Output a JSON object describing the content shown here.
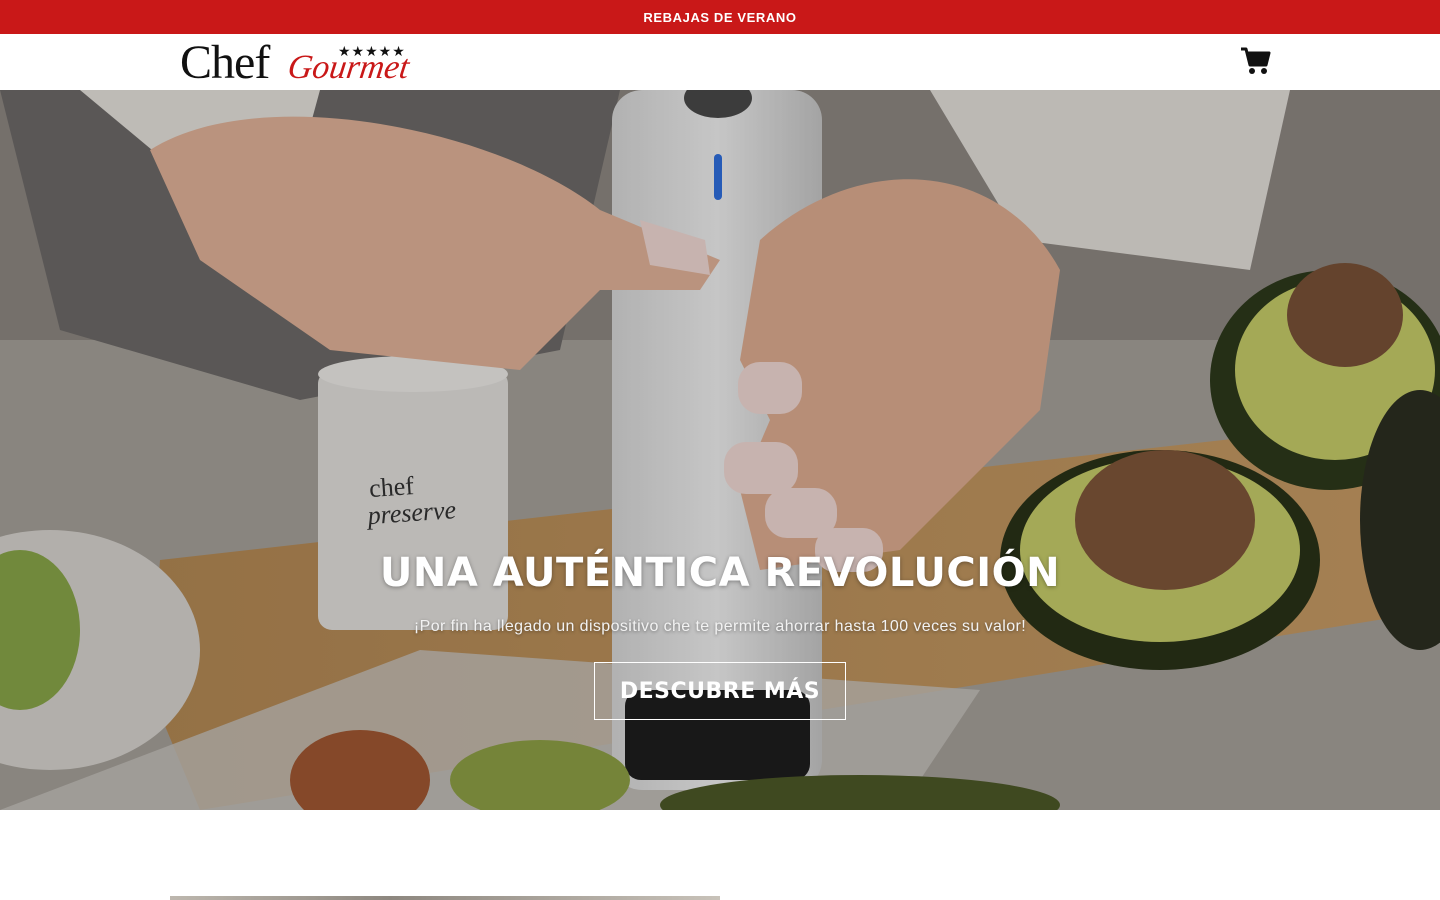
{
  "announcement": {
    "text": "REBAJAS DE VERANO",
    "background": "#c91818"
  },
  "header": {
    "logo": {
      "chef": "Chef",
      "gourmet": "Gourmet",
      "stars": "★★★★★"
    },
    "cart_icon": "shopping-cart-icon"
  },
  "hero": {
    "title": "UNA AUTÉNTICA REVOLUCIÓN",
    "subtitle": "¡Por fin ha llegado un dispositivo che te permite ahorrar hasta 100 veces su valor!",
    "button_label": "DESCUBRE MÁS",
    "cup_label_1": "chef",
    "cup_label_2": "preserve"
  }
}
